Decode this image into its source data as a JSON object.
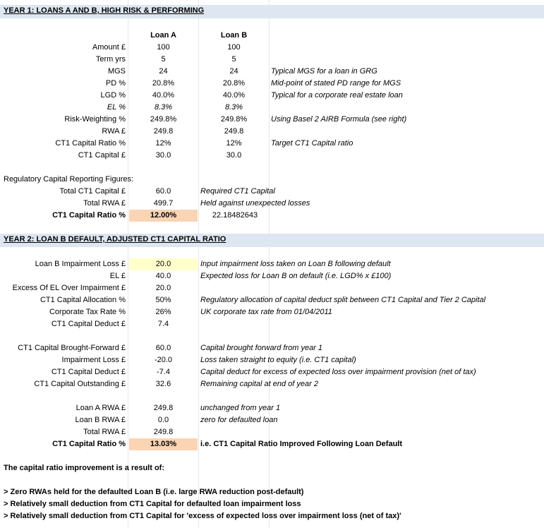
{
  "section1": {
    "title": "YEAR 1: LOANS A AND B, HIGH RISK & PERFORMING",
    "col_a": "Loan A",
    "col_b": "Loan B",
    "rows": [
      {
        "label": "Amount £",
        "a": "100",
        "b": "100",
        "note": ""
      },
      {
        "label": "Term yrs",
        "a": "5",
        "b": "5",
        "note": ""
      },
      {
        "label": "MGS",
        "a": "24",
        "b": "24",
        "note": "Typical MGS for a loan in GRG"
      },
      {
        "label": "PD %",
        "a": "20.8%",
        "b": "20.8%",
        "note": "Mid-point of stated PD range for MGS"
      },
      {
        "label": "LGD %",
        "a": "40.0%",
        "b": "40.0%",
        "note": "Typical for a corporate real estate loan"
      },
      {
        "label": "EL %",
        "a": "8.3%",
        "b": "8.3%",
        "note": ""
      },
      {
        "label": "Risk-Weighting %",
        "a": "249.8%",
        "b": "249.8%",
        "note": "Using Basel 2 AIRB Formula (see right)"
      },
      {
        "label": "RWA £",
        "a": "249.8",
        "b": "249.8",
        "note": ""
      },
      {
        "label": "CT1 Capital Ratio %",
        "a": "12%",
        "b": "12%",
        "note": "Target CT1 Capital ratio"
      },
      {
        "label": "CT1 Capital £",
        "a": "30.0",
        "b": "30.0",
        "note": ""
      }
    ],
    "reg_heading": "Regulatory Capital Reporting Figures:",
    "reg_rows": [
      {
        "label": "Total CT1 Capital £",
        "a": "60.0",
        "note": "Required CT1 Capital",
        "b": ""
      },
      {
        "label": "Total RWA £",
        "a": "499.7",
        "note": "Held against unexpected losses",
        "b": ""
      },
      {
        "label": "CT1 Capital Ratio %",
        "a": "12.00%",
        "note": "",
        "b": "22.18482643"
      }
    ]
  },
  "section2": {
    "title": "YEAR 2: LOAN B DEFAULT, ADJUSTED CT1 CAPITAL RATIO",
    "group1": [
      {
        "label": "Loan B Impairment Loss £",
        "a": "20.0",
        "note": "Input impairment loss taken on Loan B following default"
      },
      {
        "label": "EL £",
        "a": "40.0",
        "note": "Expected loss for Loan B on default (i.e. LGD% x £100)"
      },
      {
        "label": "Excess Of EL Over Impairment £",
        "a": "20.0",
        "note": ""
      },
      {
        "label": "CT1 Capital Allocation %",
        "a": "50%",
        "note": "Regulatory allocation of capital deduct split between CT1 Capital and Tier 2 Capital"
      },
      {
        "label": "Corporate Tax Rate %",
        "a": "26%",
        "note": "UK corporate tax rate from 01/04/2011"
      },
      {
        "label": "CT1 Capital Deduct £",
        "a": "7.4",
        "note": ""
      }
    ],
    "group2": [
      {
        "label": "CT1 Capital Brought-Forward £",
        "a": "60.0",
        "note": "Capital brought forward from year 1"
      },
      {
        "label": "Impairment Loss £",
        "a": "-20.0",
        "note": "Loss taken straight to equity (i.e. CT1 capital)"
      },
      {
        "label": "CT1 Capital Deduct £",
        "a": "-7.4",
        "note": "Capital deduct for excess of expected loss over impairment provision (net of tax)"
      },
      {
        "label": "CT1 Capital Outstanding £",
        "a": "32.6",
        "note": "Remaining capital at end of year 2"
      }
    ],
    "group3": [
      {
        "label": "Loan A RWA £",
        "a": "249.8",
        "note": "unchanged from year 1"
      },
      {
        "label": "Loan B RWA £",
        "a": "0.0",
        "note": "zero for defaulted loan"
      },
      {
        "label": "Total RWA £",
        "a": "249.8",
        "note": ""
      },
      {
        "label": "CT1 Capital Ratio %",
        "a": "13.03%",
        "note": "i.e. CT1 Capital Ratio Improved Following Loan Default"
      }
    ],
    "summary_heading": "The capital ratio improvement is a result of:",
    "bullets": [
      "> Zero RWAs held for the defaulted Loan B (i.e. large RWA reduction post-default)",
      "> Relatively small deduction from CT1 Capital for defaulted loan impairment loss",
      "> Relatively small deduction from CT1 Capital for 'excess of expected loss over impairment loss (net of tax)'"
    ]
  },
  "colors": {
    "section_bg": "#dde6f1",
    "input_highlight": "#ffffcc",
    "ratio_highlight": "#fbd4b4"
  }
}
